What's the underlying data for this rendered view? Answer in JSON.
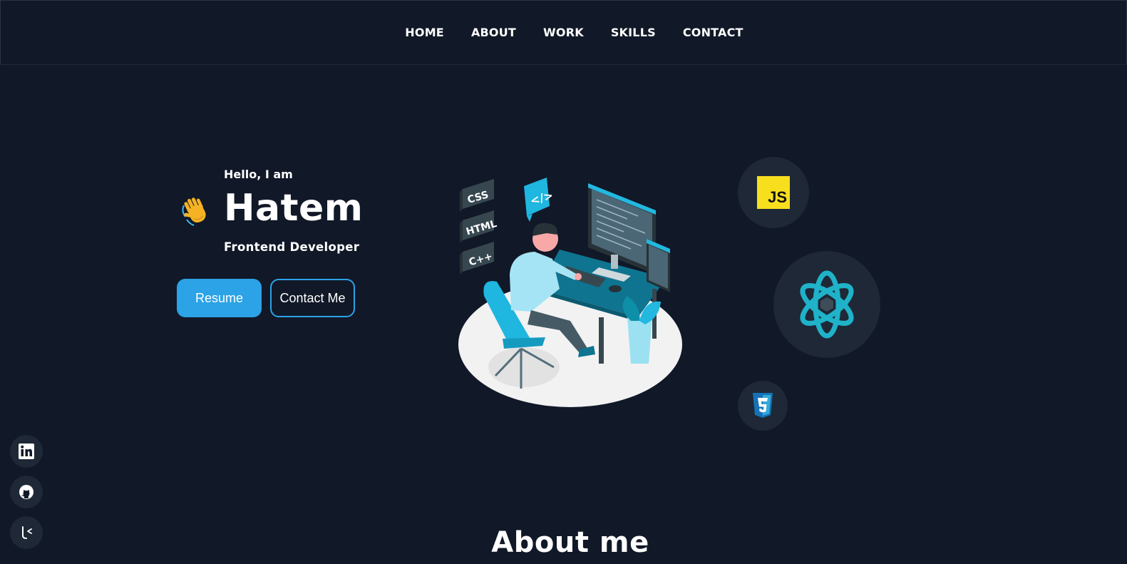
{
  "nav": {
    "items": [
      {
        "label": "HOME"
      },
      {
        "label": "ABOUT"
      },
      {
        "label": "WORK"
      },
      {
        "label": "SKILLS"
      },
      {
        "label": "CONTACT"
      }
    ]
  },
  "hero": {
    "greeting": "Hello, I am",
    "name": "Hatem",
    "role": "Frontend Developer",
    "wave_icon": "waving-hand-icon",
    "resume_label": "Resume",
    "contact_label": "Contact Me"
  },
  "illustration": {
    "tags": [
      "CSS",
      "HTML",
      "C++"
    ],
    "code_badge": "</>"
  },
  "tech_icons": {
    "js_label": "JS",
    "react_icon": "react-icon",
    "css_icon": "css3-icon"
  },
  "social": [
    {
      "icon": "linkedin-icon"
    },
    {
      "icon": "github-icon"
    },
    {
      "icon": "other-social-icon"
    }
  ],
  "about": {
    "title": "About me"
  },
  "colors": {
    "background": "#111827",
    "accent": "#2ba3e6",
    "circle": "#1e2836",
    "js_yellow": "#f7df1e"
  }
}
